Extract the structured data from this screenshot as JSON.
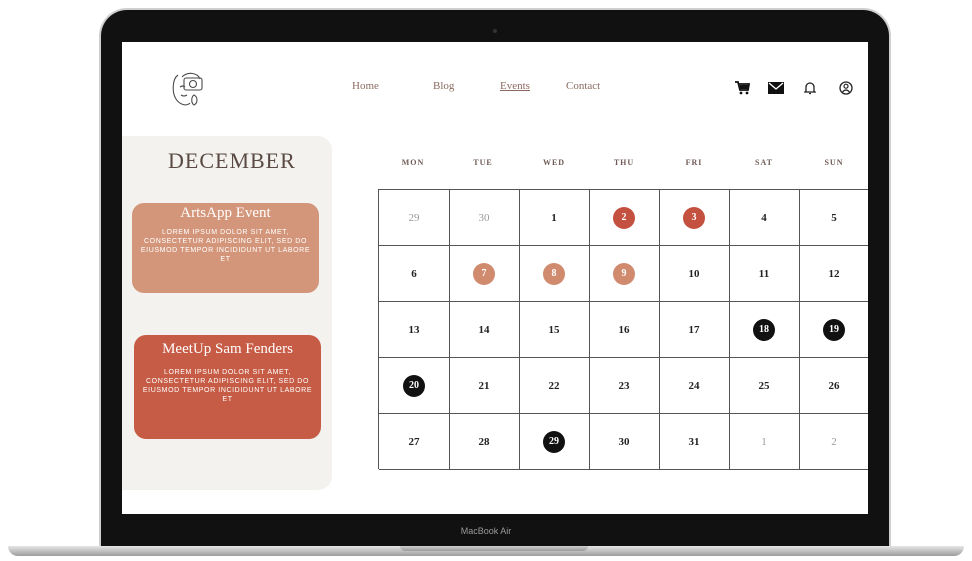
{
  "device": {
    "label": "MacBook Air"
  },
  "header": {
    "nav": [
      {
        "label": "Home",
        "active": false
      },
      {
        "label": "Blog",
        "active": false
      },
      {
        "label": "Events",
        "active": true
      },
      {
        "label": "Contact",
        "active": false
      }
    ],
    "icons": [
      "cart-icon",
      "mail-icon",
      "bell-icon",
      "account-icon"
    ]
  },
  "sidebar": {
    "month": "DECEMBER",
    "events": [
      {
        "title": "ArtsApp Event",
        "description": "LOREM IPSUM DOLOR SIT AMET, CONSECTETUR ADIPISCING ELIT, SED DO EIUSMOD TEMPOR INCIDIDUNT UT LABORE ET",
        "color": "#d4967a"
      },
      {
        "title": "MeetUp Sam Fenders",
        "description": "LOREM IPSUM DOLOR SIT AMET, CONSECTETUR ADIPISCING ELIT, SED DO EIUSMOD TEMPOR INCIDIDUNT UT LABORE ET",
        "color": "#c65c45"
      }
    ]
  },
  "calendar": {
    "weekdays": [
      "MON",
      "TUE",
      "WED",
      "THU",
      "FRI",
      "SAT",
      "SUN"
    ],
    "weeks": [
      [
        "29",
        "30",
        "1",
        "2",
        "3",
        "4",
        "5"
      ],
      [
        "6",
        "7",
        "8",
        "9",
        "10",
        "11",
        "12"
      ],
      [
        "13",
        "14",
        "15",
        "16",
        "17",
        "18",
        "19"
      ],
      [
        "20",
        "21",
        "22",
        "23",
        "24",
        "25",
        "26"
      ],
      [
        "27",
        "28",
        "29",
        "30",
        "31",
        "1",
        "2"
      ]
    ],
    "colors": {
      "red": "#c4503f",
      "peach": "#d08a6e",
      "black": "#111111"
    }
  }
}
